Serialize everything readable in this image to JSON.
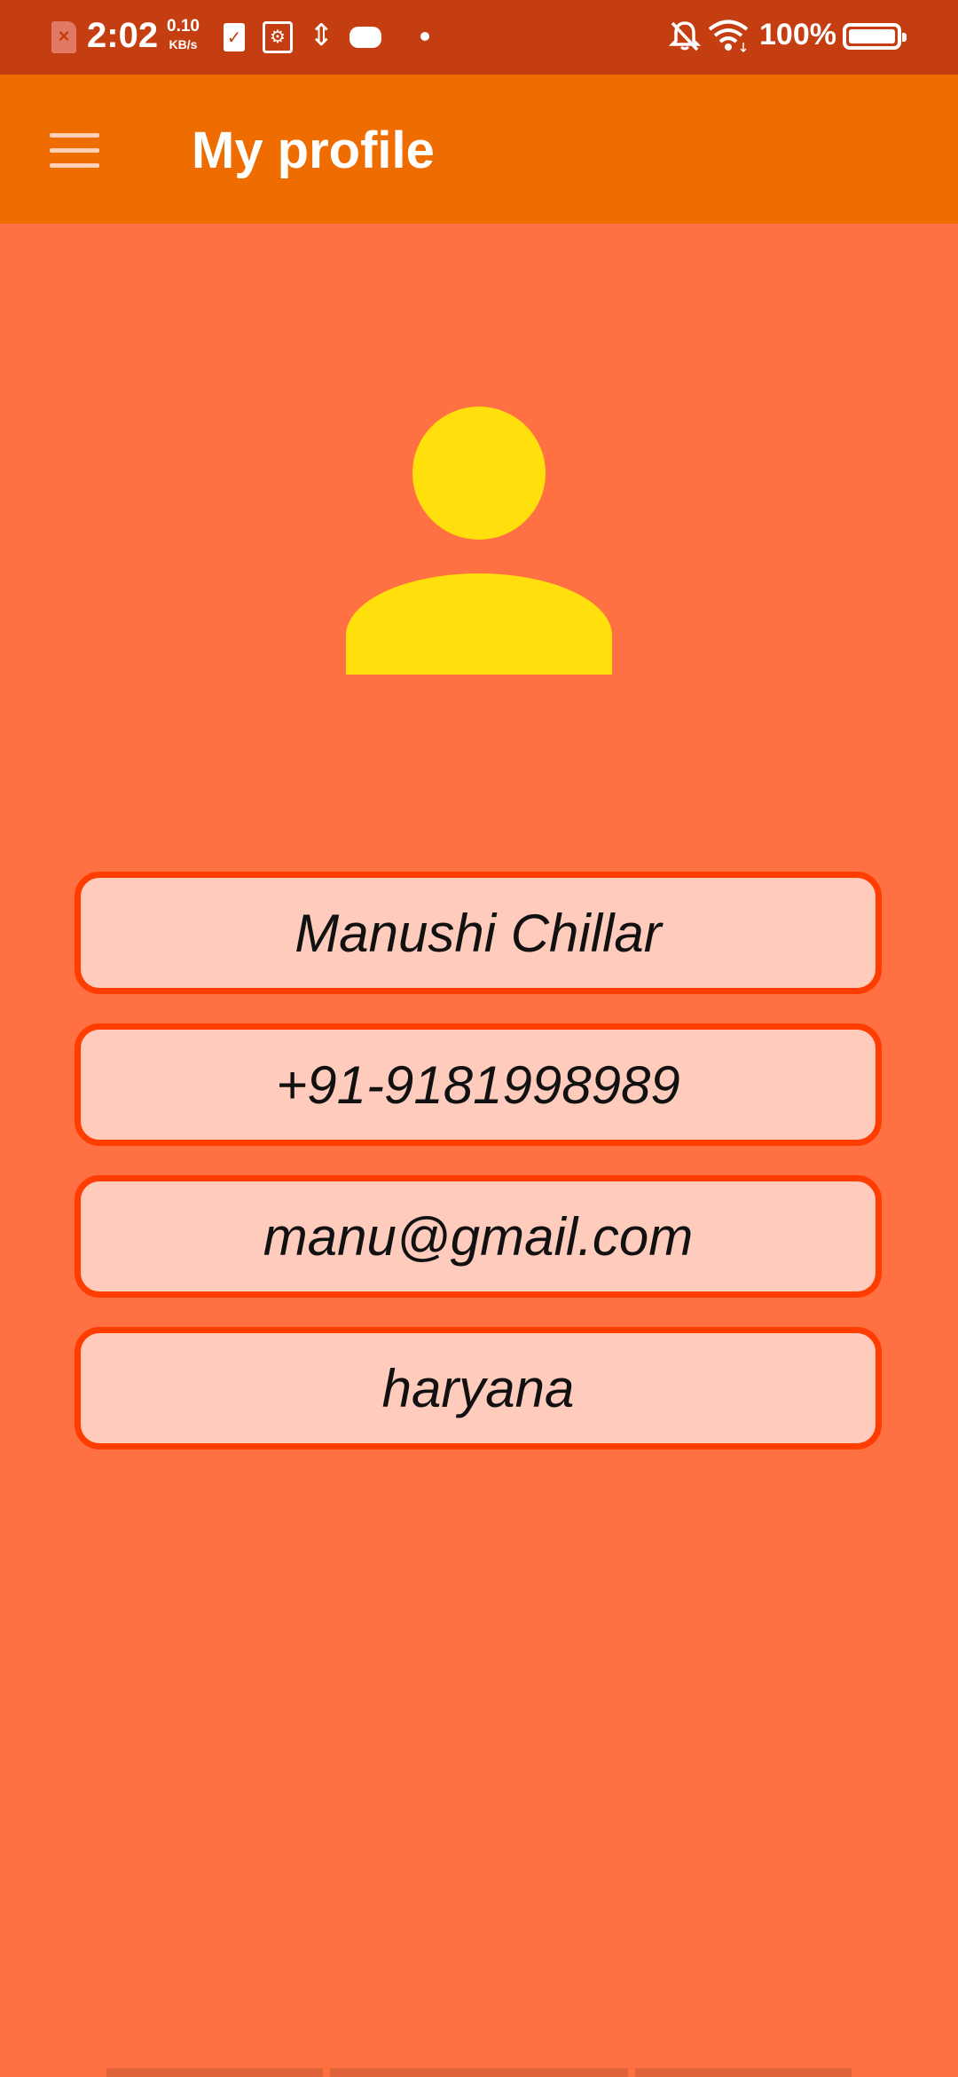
{
  "status_bar": {
    "time": "2:02",
    "net_speed_value": "0.10",
    "net_speed_unit": "KB/s",
    "battery_percent": "100%",
    "sim_icon": "sim-error-icon",
    "colors": {
      "background": "#C43E12"
    }
  },
  "app_bar": {
    "title": "My profile",
    "menu_icon": "hamburger-menu-icon",
    "color": "#EF6C00"
  },
  "profile": {
    "avatar_icon": "person-icon",
    "name": "Manushi Chillar",
    "phone": "+91-9181998989",
    "email": "manu@gmail.com",
    "location": "haryana"
  },
  "colors": {
    "page_background": "#FF7043",
    "field_border": "#FF3D00",
    "field_background": "#FFCBBC",
    "avatar": "#FFE00C"
  }
}
